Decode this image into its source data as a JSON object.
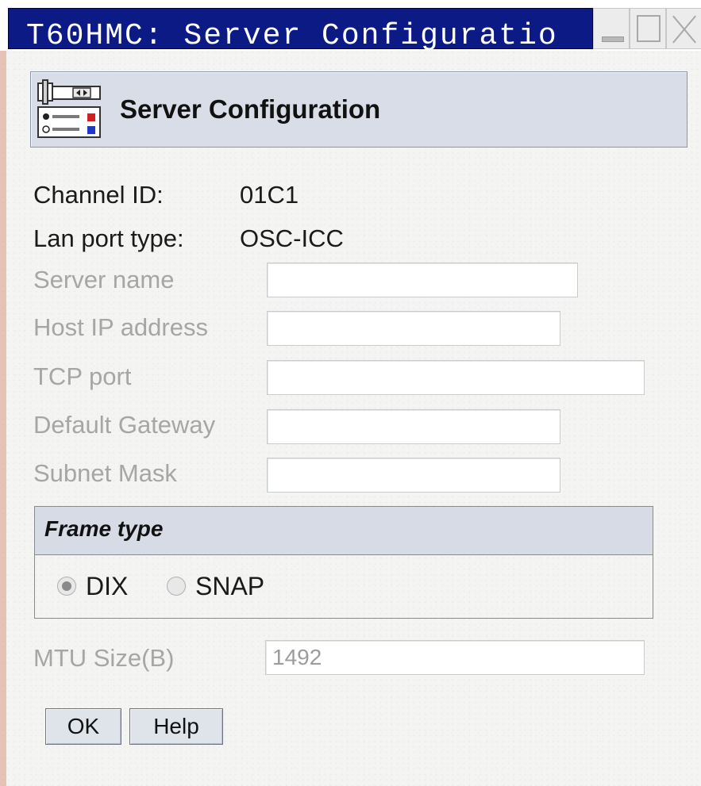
{
  "window": {
    "title": "T60HMC: Server Configuratio",
    "icons": [
      "minimize-icon",
      "maximize-icon",
      "close-icon"
    ]
  },
  "header": {
    "icon": "server-config-icon",
    "title": "Server Configuration"
  },
  "info": {
    "channel_id_label": "Channel ID:",
    "channel_id_value": "01C1",
    "lan_port_type_label": "Lan port type:",
    "lan_port_type_value": "OSC-ICC"
  },
  "fields": {
    "server_name": {
      "label": "Server name",
      "value": ""
    },
    "host_ip": {
      "label": "Host IP address",
      "value": ""
    },
    "tcp_port": {
      "label": "TCP port",
      "value": ""
    },
    "default_gateway": {
      "label": "Default Gateway",
      "value": ""
    },
    "subnet_mask": {
      "label": "Subnet Mask",
      "value": ""
    }
  },
  "frame_type": {
    "title": "Frame type",
    "options": [
      {
        "label": "DIX",
        "selected": true
      },
      {
        "label": "SNAP",
        "selected": false
      }
    ]
  },
  "mtu": {
    "label": "MTU Size(B)",
    "value": "1492"
  },
  "buttons": {
    "ok": "OK",
    "help": "Help"
  },
  "colors": {
    "title_bar": "#0c1a86",
    "header_panel": "#d8dde7",
    "disabled_text": "#a6a6a6"
  }
}
